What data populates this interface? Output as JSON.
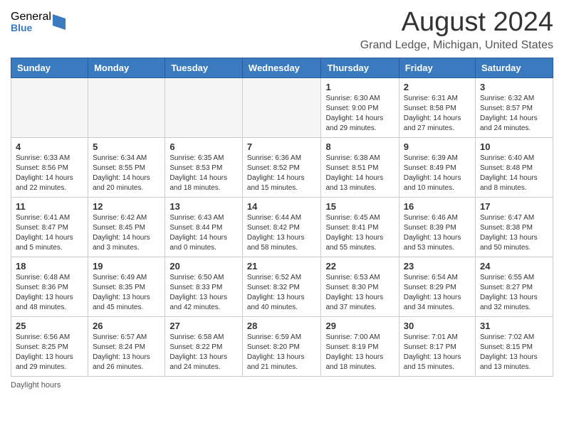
{
  "header": {
    "logo_general": "General",
    "logo_blue": "Blue",
    "month_title": "August 2024",
    "location": "Grand Ledge, Michigan, United States"
  },
  "days_of_week": [
    "Sunday",
    "Monday",
    "Tuesday",
    "Wednesday",
    "Thursday",
    "Friday",
    "Saturday"
  ],
  "footer": {
    "daylight_label": "Daylight hours"
  },
  "weeks": [
    [
      {
        "day": "",
        "info": ""
      },
      {
        "day": "",
        "info": ""
      },
      {
        "day": "",
        "info": ""
      },
      {
        "day": "",
        "info": ""
      },
      {
        "day": "1",
        "info": "Sunrise: 6:30 AM\nSunset: 9:00 PM\nDaylight: 14 hours\nand 29 minutes."
      },
      {
        "day": "2",
        "info": "Sunrise: 6:31 AM\nSunset: 8:58 PM\nDaylight: 14 hours\nand 27 minutes."
      },
      {
        "day": "3",
        "info": "Sunrise: 6:32 AM\nSunset: 8:57 PM\nDaylight: 14 hours\nand 24 minutes."
      }
    ],
    [
      {
        "day": "4",
        "info": "Sunrise: 6:33 AM\nSunset: 8:56 PM\nDaylight: 14 hours\nand 22 minutes."
      },
      {
        "day": "5",
        "info": "Sunrise: 6:34 AM\nSunset: 8:55 PM\nDaylight: 14 hours\nand 20 minutes."
      },
      {
        "day": "6",
        "info": "Sunrise: 6:35 AM\nSunset: 8:53 PM\nDaylight: 14 hours\nand 18 minutes."
      },
      {
        "day": "7",
        "info": "Sunrise: 6:36 AM\nSunset: 8:52 PM\nDaylight: 14 hours\nand 15 minutes."
      },
      {
        "day": "8",
        "info": "Sunrise: 6:38 AM\nSunset: 8:51 PM\nDaylight: 14 hours\nand 13 minutes."
      },
      {
        "day": "9",
        "info": "Sunrise: 6:39 AM\nSunset: 8:49 PM\nDaylight: 14 hours\nand 10 minutes."
      },
      {
        "day": "10",
        "info": "Sunrise: 6:40 AM\nSunset: 8:48 PM\nDaylight: 14 hours\nand 8 minutes."
      }
    ],
    [
      {
        "day": "11",
        "info": "Sunrise: 6:41 AM\nSunset: 8:47 PM\nDaylight: 14 hours\nand 5 minutes."
      },
      {
        "day": "12",
        "info": "Sunrise: 6:42 AM\nSunset: 8:45 PM\nDaylight: 14 hours\nand 3 minutes."
      },
      {
        "day": "13",
        "info": "Sunrise: 6:43 AM\nSunset: 8:44 PM\nDaylight: 14 hours\nand 0 minutes."
      },
      {
        "day": "14",
        "info": "Sunrise: 6:44 AM\nSunset: 8:42 PM\nDaylight: 13 hours\nand 58 minutes."
      },
      {
        "day": "15",
        "info": "Sunrise: 6:45 AM\nSunset: 8:41 PM\nDaylight: 13 hours\nand 55 minutes."
      },
      {
        "day": "16",
        "info": "Sunrise: 6:46 AM\nSunset: 8:39 PM\nDaylight: 13 hours\nand 53 minutes."
      },
      {
        "day": "17",
        "info": "Sunrise: 6:47 AM\nSunset: 8:38 PM\nDaylight: 13 hours\nand 50 minutes."
      }
    ],
    [
      {
        "day": "18",
        "info": "Sunrise: 6:48 AM\nSunset: 8:36 PM\nDaylight: 13 hours\nand 48 minutes."
      },
      {
        "day": "19",
        "info": "Sunrise: 6:49 AM\nSunset: 8:35 PM\nDaylight: 13 hours\nand 45 minutes."
      },
      {
        "day": "20",
        "info": "Sunrise: 6:50 AM\nSunset: 8:33 PM\nDaylight: 13 hours\nand 42 minutes."
      },
      {
        "day": "21",
        "info": "Sunrise: 6:52 AM\nSunset: 8:32 PM\nDaylight: 13 hours\nand 40 minutes."
      },
      {
        "day": "22",
        "info": "Sunrise: 6:53 AM\nSunset: 8:30 PM\nDaylight: 13 hours\nand 37 minutes."
      },
      {
        "day": "23",
        "info": "Sunrise: 6:54 AM\nSunset: 8:29 PM\nDaylight: 13 hours\nand 34 minutes."
      },
      {
        "day": "24",
        "info": "Sunrise: 6:55 AM\nSunset: 8:27 PM\nDaylight: 13 hours\nand 32 minutes."
      }
    ],
    [
      {
        "day": "25",
        "info": "Sunrise: 6:56 AM\nSunset: 8:25 PM\nDaylight: 13 hours\nand 29 minutes."
      },
      {
        "day": "26",
        "info": "Sunrise: 6:57 AM\nSunset: 8:24 PM\nDaylight: 13 hours\nand 26 minutes."
      },
      {
        "day": "27",
        "info": "Sunrise: 6:58 AM\nSunset: 8:22 PM\nDaylight: 13 hours\nand 24 minutes."
      },
      {
        "day": "28",
        "info": "Sunrise: 6:59 AM\nSunset: 8:20 PM\nDaylight: 13 hours\nand 21 minutes."
      },
      {
        "day": "29",
        "info": "Sunrise: 7:00 AM\nSunset: 8:19 PM\nDaylight: 13 hours\nand 18 minutes."
      },
      {
        "day": "30",
        "info": "Sunrise: 7:01 AM\nSunset: 8:17 PM\nDaylight: 13 hours\nand 15 minutes."
      },
      {
        "day": "31",
        "info": "Sunrise: 7:02 AM\nSunset: 8:15 PM\nDaylight: 13 hours\nand 13 minutes."
      }
    ]
  ]
}
